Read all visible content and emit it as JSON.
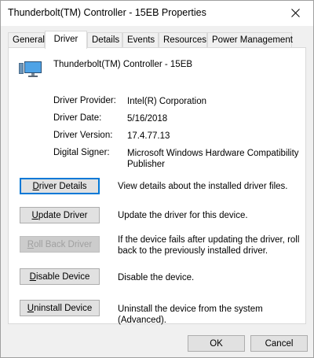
{
  "window": {
    "title": "Thunderbolt(TM) Controller - 15EB Properties"
  },
  "tabs": [
    {
      "label": "General"
    },
    {
      "label": "Driver"
    },
    {
      "label": "Details"
    },
    {
      "label": "Events"
    },
    {
      "label": "Resources"
    },
    {
      "label": "Power Management"
    }
  ],
  "device": {
    "name": "Thunderbolt(TM) Controller - 15EB",
    "icon": "monitor-device-icon"
  },
  "driver_info": [
    {
      "label": "Driver Provider:",
      "value": "Intel(R) Corporation"
    },
    {
      "label": "Driver Date:",
      "value": "5/16/2018"
    },
    {
      "label": "Driver Version:",
      "value": "17.4.77.13"
    },
    {
      "label": "Digital Signer:",
      "value": "Microsoft Windows Hardware Compatibility Publisher"
    }
  ],
  "actions": {
    "details": {
      "pre": "",
      "key": "D",
      "post": "river Details",
      "desc": "View details about the installed driver files."
    },
    "update": {
      "pre": "",
      "key": "U",
      "post": "pdate Driver",
      "desc": "Update the driver for this device."
    },
    "rollback": {
      "pre": "",
      "key": "R",
      "post": "oll Back Driver",
      "desc": "If the device fails after updating the driver, roll back to the previously installed driver."
    },
    "disable": {
      "pre": "",
      "key": "D",
      "post": "isable Device",
      "desc": "Disable the device."
    },
    "uninstall": {
      "pre": "",
      "key": "U",
      "post": "ninstall Device",
      "desc": "Uninstall the device from the system (Advanced)."
    }
  },
  "footer": {
    "ok": "OK",
    "cancel": "Cancel"
  }
}
